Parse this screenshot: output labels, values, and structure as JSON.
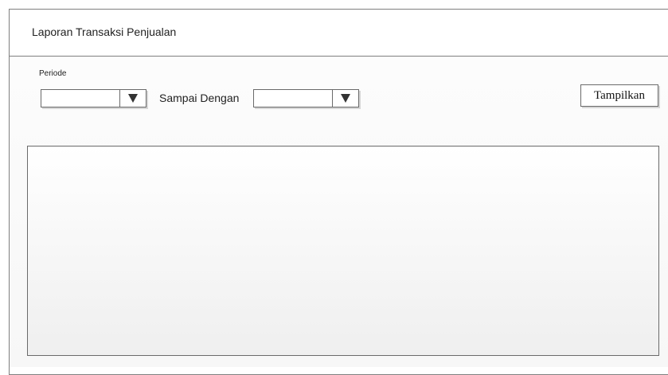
{
  "window": {
    "title": "Laporan Transaksi Penjualan"
  },
  "filter": {
    "periode_label": "Periode",
    "from_value": "",
    "to_label": "Sampai Dengan",
    "to_value": "",
    "submit_label": "Tampilkan"
  },
  "icons": {
    "dropdown_arrow": "triangle-down-icon"
  },
  "colors": {
    "border": "#6a6a6a",
    "arrow": "#333333"
  }
}
